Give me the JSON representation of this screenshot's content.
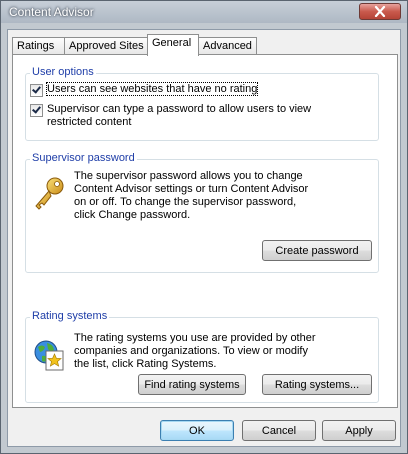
{
  "window": {
    "title": "Content Advisor"
  },
  "tabs": [
    {
      "label": "Ratings"
    },
    {
      "label": "Approved Sites"
    },
    {
      "label": "General"
    },
    {
      "label": "Advanced"
    }
  ],
  "active_tab": "General",
  "user_options": {
    "label": "User options",
    "option1": {
      "label": "Users can see websites that have no rating",
      "checked": true
    },
    "option2": {
      "label": "Supervisor can type a password to allow users to view restricted content",
      "checked": true
    }
  },
  "supervisor_password": {
    "label": "Supervisor password",
    "description": "The supervisor password allows you to change Content Advisor settings or turn Content Advisor on or off. To change the supervisor password, click Change password.",
    "button": "Create password",
    "icon": "key-icon"
  },
  "rating_systems": {
    "label": "Rating systems",
    "description": "The rating systems you use are provided by other companies and organizations. To view or modify the list, click Rating Systems.",
    "find_button": "Find rating systems",
    "rating_button": "Rating systems...",
    "icon": "globe-star-icon"
  },
  "footer": {
    "ok": "OK",
    "cancel": "Cancel",
    "apply": "Apply"
  },
  "colors": {
    "group_label": "#1f3ea8",
    "close_button": "#c95a4d"
  }
}
